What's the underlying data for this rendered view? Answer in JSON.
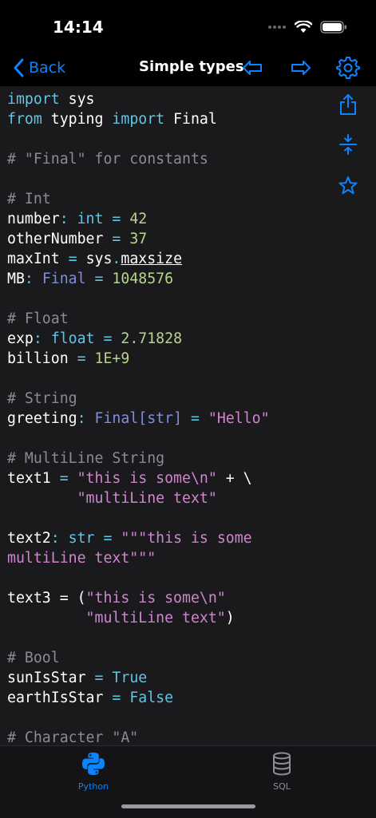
{
  "status_bar": {
    "time": "14:14"
  },
  "nav": {
    "back_label": "Back",
    "title": "Simple types"
  },
  "icons": {
    "back": "chevron-left-icon",
    "prev": "arrow-left-icon",
    "next": "arrow-right-icon",
    "settings": "gear-icon",
    "share": "share-icon",
    "collapse": "collapse-icon",
    "favorite": "star-icon"
  },
  "colors": {
    "accent": "#0a84ff",
    "background": "#1a1a1d",
    "keyword": "#5fc6e6",
    "number": "#b8d58c",
    "string": "#cf86cf",
    "comment": "#8b8b90",
    "type": "#7f8fe0"
  },
  "code": [
    [
      {
        "t": "import",
        "c": "kw"
      },
      {
        "t": " sys",
        "c": "id"
      }
    ],
    [
      {
        "t": "from",
        "c": "kw"
      },
      {
        "t": " typing ",
        "c": "id"
      },
      {
        "t": "import",
        "c": "kw"
      },
      {
        "t": " Final",
        "c": "id"
      }
    ],
    [],
    [
      {
        "t": "# \"Final\" for constants",
        "c": "cm"
      }
    ],
    [],
    [
      {
        "t": "# Int",
        "c": "cm"
      }
    ],
    [
      {
        "t": "number",
        "c": "id"
      },
      {
        "t": ": ",
        "c": "op"
      },
      {
        "t": "int",
        "c": "kw"
      },
      {
        "t": " = ",
        "c": "op"
      },
      {
        "t": "42",
        "c": "num"
      }
    ],
    [
      {
        "t": "otherNumber",
        "c": "id"
      },
      {
        "t": " = ",
        "c": "op"
      },
      {
        "t": "37",
        "c": "num"
      }
    ],
    [
      {
        "t": "maxInt",
        "c": "id"
      },
      {
        "t": " = ",
        "c": "op"
      },
      {
        "t": "sys",
        "c": "id"
      },
      {
        "t": ".",
        "c": "op"
      },
      {
        "t": "maxsize",
        "c": "ul"
      }
    ],
    [
      {
        "t": "MB",
        "c": "id"
      },
      {
        "t": ": ",
        "c": "op"
      },
      {
        "t": "Final",
        "c": "type"
      },
      {
        "t": " = ",
        "c": "op"
      },
      {
        "t": "1048576",
        "c": "num"
      }
    ],
    [],
    [
      {
        "t": "# Float",
        "c": "cm"
      }
    ],
    [
      {
        "t": "exp",
        "c": "id"
      },
      {
        "t": ": ",
        "c": "op"
      },
      {
        "t": "float",
        "c": "kw"
      },
      {
        "t": " = ",
        "c": "op"
      },
      {
        "t": "2.71828",
        "c": "num"
      }
    ],
    [
      {
        "t": "billion",
        "c": "id"
      },
      {
        "t": " = ",
        "c": "op"
      },
      {
        "t": "1E+9",
        "c": "num"
      }
    ],
    [],
    [
      {
        "t": "# String",
        "c": "cm"
      }
    ],
    [
      {
        "t": "greeting",
        "c": "id"
      },
      {
        "t": ": ",
        "c": "op"
      },
      {
        "t": "Final[str]",
        "c": "type"
      },
      {
        "t": " = ",
        "c": "op"
      },
      {
        "t": "\"Hello\"",
        "c": "str"
      }
    ],
    [],
    [
      {
        "t": "# MultiLine String",
        "c": "cm"
      }
    ],
    [
      {
        "t": "text1",
        "c": "id"
      },
      {
        "t": " = ",
        "c": "op"
      },
      {
        "t": "\"this is some\\n\"",
        "c": "str"
      },
      {
        "t": " + \\",
        "c": "id"
      }
    ],
    [
      {
        "t": "        \"multiLine text\"",
        "c": "str"
      }
    ],
    [],
    [
      {
        "t": "text2",
        "c": "id"
      },
      {
        "t": ": ",
        "c": "op"
      },
      {
        "t": "str",
        "c": "kw"
      },
      {
        "t": " = ",
        "c": "op"
      },
      {
        "t": "\"\"\"this is some",
        "c": "str"
      }
    ],
    [
      {
        "t": "multiLine text\"\"\"",
        "c": "str"
      }
    ],
    [],
    [
      {
        "t": "text3",
        "c": "id"
      },
      {
        "t": " = (",
        "c": "id"
      },
      {
        "t": "\"this is some\\n\"",
        "c": "str"
      }
    ],
    [
      {
        "t": "         \"multiLine text\"",
        "c": "str"
      },
      {
        "t": ")",
        "c": "id"
      }
    ],
    [],
    [
      {
        "t": "# Bool",
        "c": "cm"
      }
    ],
    [
      {
        "t": "sunIsStar",
        "c": "id"
      },
      {
        "t": " = ",
        "c": "op"
      },
      {
        "t": "True",
        "c": "bool"
      }
    ],
    [
      {
        "t": "earthIsStar",
        "c": "id"
      },
      {
        "t": " = ",
        "c": "op"
      },
      {
        "t": "False",
        "c": "bool"
      }
    ],
    [],
    [
      {
        "t": "# Character \"A\"",
        "c": "cm"
      }
    ]
  ],
  "tabs": [
    {
      "label": "Python",
      "active": true,
      "icon": "python-icon"
    },
    {
      "label": "SQL",
      "active": false,
      "icon": "database-icon"
    }
  ]
}
